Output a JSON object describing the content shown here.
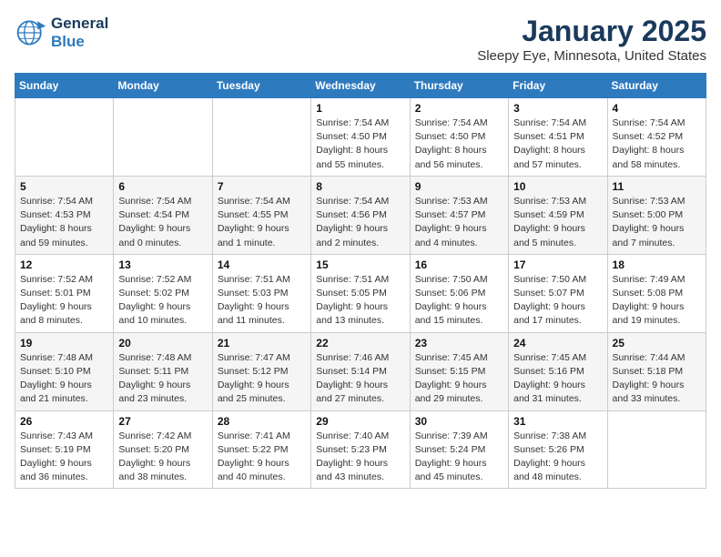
{
  "header": {
    "logo_line1": "General",
    "logo_line2": "Blue",
    "title": "January 2025",
    "subtitle": "Sleepy Eye, Minnesota, United States"
  },
  "days_of_week": [
    "Sunday",
    "Monday",
    "Tuesday",
    "Wednesday",
    "Thursday",
    "Friday",
    "Saturday"
  ],
  "weeks": [
    [
      {
        "day": "",
        "info": ""
      },
      {
        "day": "",
        "info": ""
      },
      {
        "day": "",
        "info": ""
      },
      {
        "day": "1",
        "info": "Sunrise: 7:54 AM\nSunset: 4:50 PM\nDaylight: 8 hours\nand 55 minutes."
      },
      {
        "day": "2",
        "info": "Sunrise: 7:54 AM\nSunset: 4:50 PM\nDaylight: 8 hours\nand 56 minutes."
      },
      {
        "day": "3",
        "info": "Sunrise: 7:54 AM\nSunset: 4:51 PM\nDaylight: 8 hours\nand 57 minutes."
      },
      {
        "day": "4",
        "info": "Sunrise: 7:54 AM\nSunset: 4:52 PM\nDaylight: 8 hours\nand 58 minutes."
      }
    ],
    [
      {
        "day": "5",
        "info": "Sunrise: 7:54 AM\nSunset: 4:53 PM\nDaylight: 8 hours\nand 59 minutes."
      },
      {
        "day": "6",
        "info": "Sunrise: 7:54 AM\nSunset: 4:54 PM\nDaylight: 9 hours\nand 0 minutes."
      },
      {
        "day": "7",
        "info": "Sunrise: 7:54 AM\nSunset: 4:55 PM\nDaylight: 9 hours\nand 1 minute."
      },
      {
        "day": "8",
        "info": "Sunrise: 7:54 AM\nSunset: 4:56 PM\nDaylight: 9 hours\nand 2 minutes."
      },
      {
        "day": "9",
        "info": "Sunrise: 7:53 AM\nSunset: 4:57 PM\nDaylight: 9 hours\nand 4 minutes."
      },
      {
        "day": "10",
        "info": "Sunrise: 7:53 AM\nSunset: 4:59 PM\nDaylight: 9 hours\nand 5 minutes."
      },
      {
        "day": "11",
        "info": "Sunrise: 7:53 AM\nSunset: 5:00 PM\nDaylight: 9 hours\nand 7 minutes."
      }
    ],
    [
      {
        "day": "12",
        "info": "Sunrise: 7:52 AM\nSunset: 5:01 PM\nDaylight: 9 hours\nand 8 minutes."
      },
      {
        "day": "13",
        "info": "Sunrise: 7:52 AM\nSunset: 5:02 PM\nDaylight: 9 hours\nand 10 minutes."
      },
      {
        "day": "14",
        "info": "Sunrise: 7:51 AM\nSunset: 5:03 PM\nDaylight: 9 hours\nand 11 minutes."
      },
      {
        "day": "15",
        "info": "Sunrise: 7:51 AM\nSunset: 5:05 PM\nDaylight: 9 hours\nand 13 minutes."
      },
      {
        "day": "16",
        "info": "Sunrise: 7:50 AM\nSunset: 5:06 PM\nDaylight: 9 hours\nand 15 minutes."
      },
      {
        "day": "17",
        "info": "Sunrise: 7:50 AM\nSunset: 5:07 PM\nDaylight: 9 hours\nand 17 minutes."
      },
      {
        "day": "18",
        "info": "Sunrise: 7:49 AM\nSunset: 5:08 PM\nDaylight: 9 hours\nand 19 minutes."
      }
    ],
    [
      {
        "day": "19",
        "info": "Sunrise: 7:48 AM\nSunset: 5:10 PM\nDaylight: 9 hours\nand 21 minutes."
      },
      {
        "day": "20",
        "info": "Sunrise: 7:48 AM\nSunset: 5:11 PM\nDaylight: 9 hours\nand 23 minutes."
      },
      {
        "day": "21",
        "info": "Sunrise: 7:47 AM\nSunset: 5:12 PM\nDaylight: 9 hours\nand 25 minutes."
      },
      {
        "day": "22",
        "info": "Sunrise: 7:46 AM\nSunset: 5:14 PM\nDaylight: 9 hours\nand 27 minutes."
      },
      {
        "day": "23",
        "info": "Sunrise: 7:45 AM\nSunset: 5:15 PM\nDaylight: 9 hours\nand 29 minutes."
      },
      {
        "day": "24",
        "info": "Sunrise: 7:45 AM\nSunset: 5:16 PM\nDaylight: 9 hours\nand 31 minutes."
      },
      {
        "day": "25",
        "info": "Sunrise: 7:44 AM\nSunset: 5:18 PM\nDaylight: 9 hours\nand 33 minutes."
      }
    ],
    [
      {
        "day": "26",
        "info": "Sunrise: 7:43 AM\nSunset: 5:19 PM\nDaylight: 9 hours\nand 36 minutes."
      },
      {
        "day": "27",
        "info": "Sunrise: 7:42 AM\nSunset: 5:20 PM\nDaylight: 9 hours\nand 38 minutes."
      },
      {
        "day": "28",
        "info": "Sunrise: 7:41 AM\nSunset: 5:22 PM\nDaylight: 9 hours\nand 40 minutes."
      },
      {
        "day": "29",
        "info": "Sunrise: 7:40 AM\nSunset: 5:23 PM\nDaylight: 9 hours\nand 43 minutes."
      },
      {
        "day": "30",
        "info": "Sunrise: 7:39 AM\nSunset: 5:24 PM\nDaylight: 9 hours\nand 45 minutes."
      },
      {
        "day": "31",
        "info": "Sunrise: 7:38 AM\nSunset: 5:26 PM\nDaylight: 9 hours\nand 48 minutes."
      },
      {
        "day": "",
        "info": ""
      }
    ]
  ]
}
